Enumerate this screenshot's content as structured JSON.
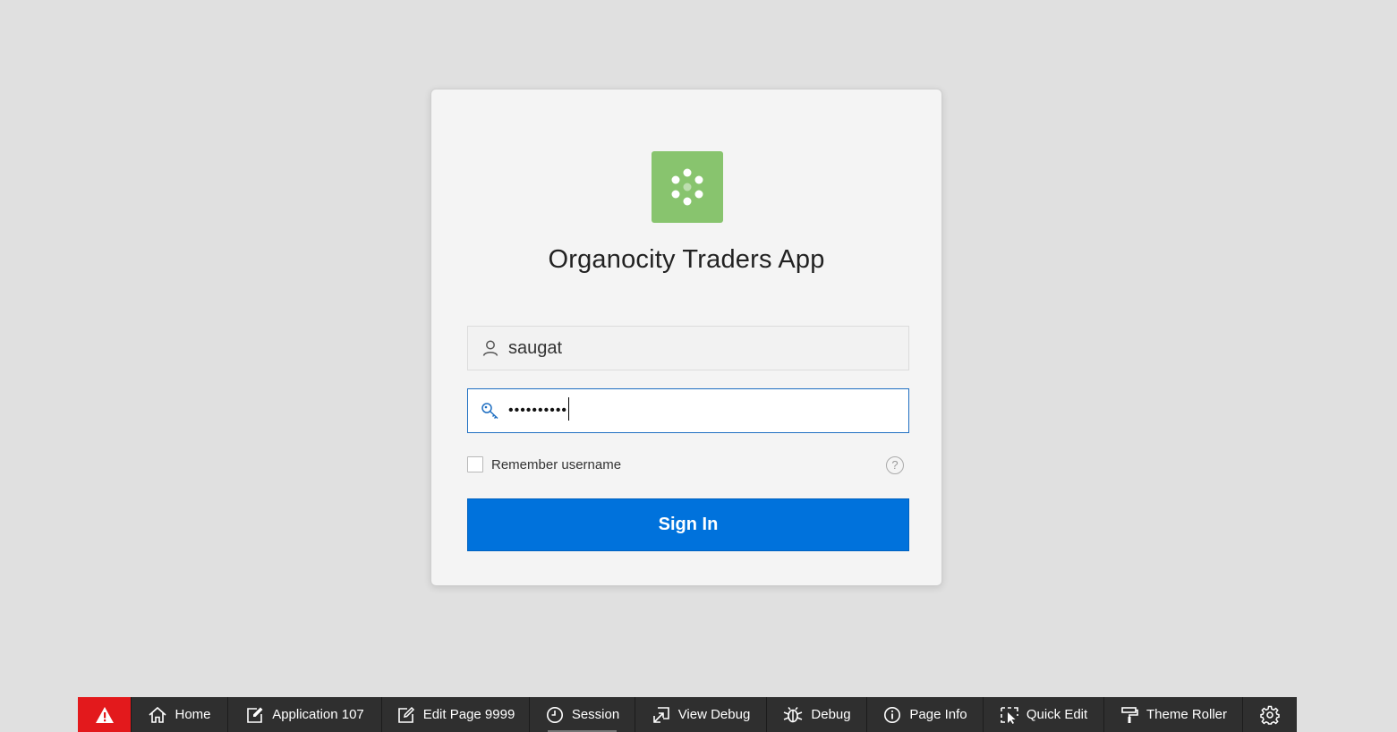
{
  "app": {
    "title": "Organocity Traders App"
  },
  "login": {
    "username_value": "saugat",
    "password_mask": "••••••••••",
    "remember_label": "Remember username",
    "help_glyph": "?",
    "signin_label": "Sign In"
  },
  "devbar": {
    "items": [
      {
        "label": "Home",
        "icon": "home-icon"
      },
      {
        "label": "Application 107",
        "icon": "edit-app-icon"
      },
      {
        "label": "Edit Page 9999",
        "icon": "pencil-icon"
      },
      {
        "label": "Session",
        "icon": "clock-icon"
      },
      {
        "label": "View Debug",
        "icon": "view-debug-icon"
      },
      {
        "label": "Debug",
        "icon": "bug-icon"
      },
      {
        "label": "Page Info",
        "icon": "info-icon"
      },
      {
        "label": "Quick Edit",
        "icon": "quick-edit-icon"
      },
      {
        "label": "Theme Roller",
        "icon": "paint-roller-icon"
      }
    ]
  },
  "colors": {
    "background": "#e0e0e0",
    "card": "#f4f4f4",
    "logo": "#88c46e",
    "primary_button": "#0072dc",
    "devbar": "#2f2f2f",
    "alert": "#e3191c",
    "focus_border": "#1f6fc2"
  }
}
